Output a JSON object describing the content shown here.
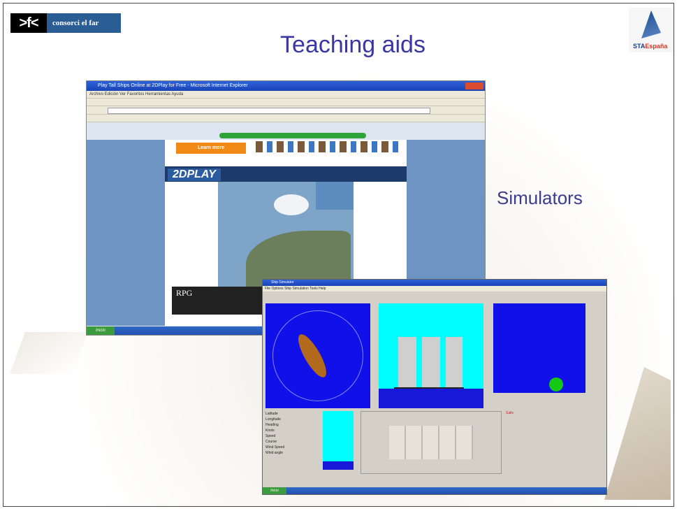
{
  "slide": {
    "title": "Teaching aids",
    "subtitle": "Simulators"
  },
  "logos": {
    "left_mark": ">f<",
    "left_text": "consorci el far",
    "right_text_a": "STA",
    "right_text_b": "España"
  },
  "screenshot1": {
    "window_title": "Play Tall Ships Online at 2DPlay for Free - Microsoft Internet Explorer",
    "menu": "Archivo  Edición  Ver  Favoritos  Herramientas  Ayuda",
    "banner_button": "Learn more",
    "site_logo": "2DPLAY",
    "game_banner": "RPG",
    "start_label": "Inicio"
  },
  "screenshot2": {
    "window_title": "Ship Simulator",
    "menu": "File  Options  Ship  Simulation  Tools  Help",
    "info_lines": [
      "Latitude",
      "Longitude",
      "Heading",
      "Knots",
      "Speed",
      "Course",
      "Wind Speed",
      "Wind angle"
    ],
    "right_header": "Sails",
    "start_label": "Inicio"
  },
  "colors": {
    "title": "#3a37a2",
    "subtitle": "#3b3c8b",
    "radar_bg": "#1010e8",
    "sky": "#00ffff"
  }
}
